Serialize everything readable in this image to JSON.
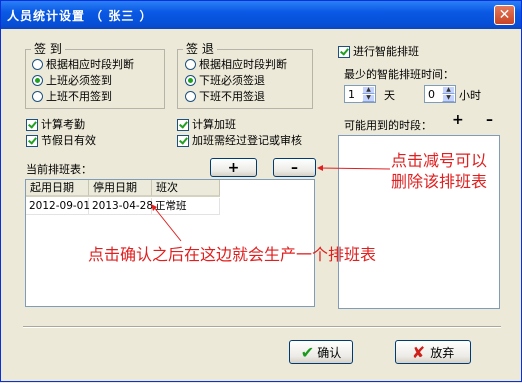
{
  "window": {
    "title": "人员统计设置 （ 张三 ）"
  },
  "signin": {
    "legend": "签 到",
    "options": [
      {
        "label": "根据相应时段判断",
        "selected": false
      },
      {
        "label": "上班必须签到",
        "selected": true
      },
      {
        "label": "上班不用签到",
        "selected": false
      }
    ]
  },
  "signout": {
    "legend": "签 退",
    "options": [
      {
        "label": "根据相应时段判断",
        "selected": false
      },
      {
        "label": "下班必须签退",
        "selected": true
      },
      {
        "label": "下班不用签退",
        "selected": false
      }
    ]
  },
  "smart": {
    "enable_label": "进行智能排班",
    "enabled": true,
    "min_time_label": "最少的智能排班时间：",
    "days_value": "1",
    "days_unit": "天",
    "hours_value": "0",
    "hours_unit": "小时",
    "periods_label": "可能用到的时段：",
    "add_symbol": "+",
    "remove_symbol": "–"
  },
  "options": {
    "calc_attendance": "计算考勤",
    "holiday_valid": "节假日有效",
    "calc_overtime": "计算加班",
    "overtime_register": "加班需经过登记或审核"
  },
  "schedule": {
    "label": "当前排班表：",
    "add_symbol": "+",
    "remove_symbol": "–",
    "columns": [
      "起用日期",
      "停用日期",
      "班次"
    ],
    "rows": [
      [
        "2012-09-01",
        "2013-04-28",
        "正常班"
      ]
    ]
  },
  "annotations": {
    "remove_note_line1": "点击减号可以",
    "remove_note_line2": "删除该排班表",
    "confirm_note": "点击确认之后在这边就会生产一个排班表"
  },
  "buttons": {
    "ok": "确认",
    "cancel": "放弃"
  },
  "colors": {
    "annotation": "#e02020",
    "titlebar": "#0a58e4"
  }
}
